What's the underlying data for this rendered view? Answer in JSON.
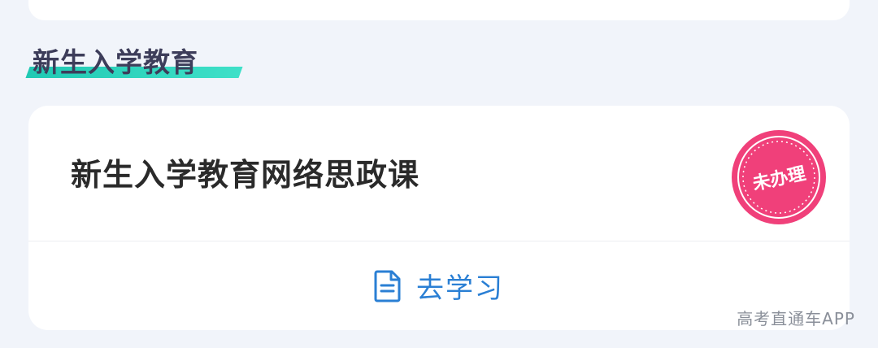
{
  "section": {
    "title": "新生入学教育"
  },
  "course": {
    "title": "新生入学教育网络思政课",
    "status_stamp": "未办理",
    "action_label": "去学习",
    "action_icon": "document-icon"
  },
  "colors": {
    "accent_teal": "#20c9b3",
    "link_blue": "#2a7fd4",
    "stamp_pink": "#f0407a"
  },
  "watermark": "高考直通车APP"
}
